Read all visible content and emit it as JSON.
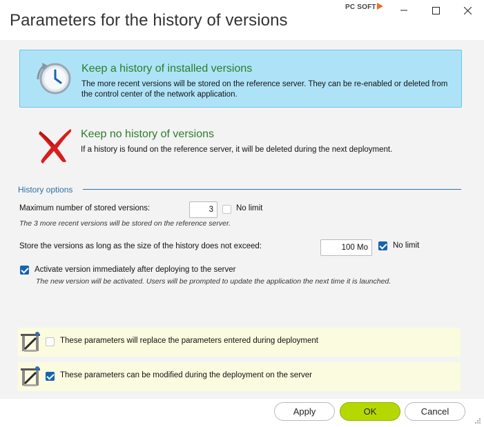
{
  "window": {
    "title": "Parameters for the history of versions",
    "logo": "PC SOFT"
  },
  "options": {
    "keep_history": {
      "title": "Keep a history of installed versions",
      "desc": "The more recent versions will be stored on the reference server. They can be re-enabled or deleted from the control center of the network application.",
      "selected": true,
      "icon": "history-clock-icon"
    },
    "no_history": {
      "title": "Keep no history of versions",
      "desc": "If a history is found on the reference server, it will be deleted during the next deployment.",
      "selected": false,
      "icon": "red-x-icon"
    }
  },
  "history_options": {
    "label": "History options",
    "max_versions": {
      "label": "Maximum number of stored versions:",
      "value": "3",
      "no_limit_label": "No limit",
      "no_limit_checked": false,
      "hint": "The 3 more recent versions will be stored on the reference server."
    },
    "max_size": {
      "label": "Store the versions as long as the size of the history does not exceed:",
      "value": "100 Mo",
      "no_limit_label": "No limit",
      "no_limit_checked": true
    },
    "activate": {
      "label": "Activate version immediately after deploying to the server",
      "checked": true,
      "hint": "The new version will be activated. Users will be prompted to update the application the next time it is launched."
    }
  },
  "notes": {
    "replace": {
      "label": "These parameters will replace the parameters entered during deployment",
      "checked": false
    },
    "modifiable": {
      "label": "These parameters can be modified during the deployment on the server",
      "checked": true
    }
  },
  "buttons": {
    "apply": "Apply",
    "ok": "OK",
    "cancel": "Cancel"
  },
  "colors": {
    "accent": "#1464b4",
    "selected_bg": "#aee3f7",
    "ok_button": "#b5d900",
    "title_green": "#2b7d2b",
    "note_bg": "#fbfbdf"
  }
}
